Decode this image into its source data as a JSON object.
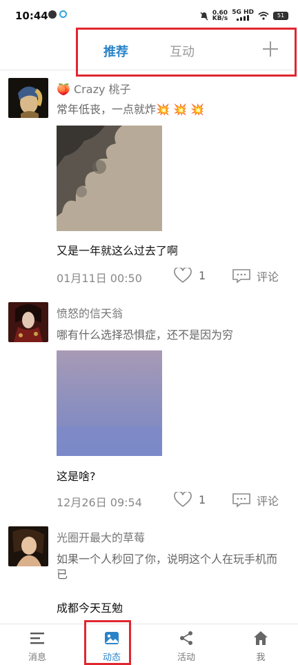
{
  "status": {
    "time": "10:44",
    "speed": "0.60",
    "speed_unit": "KB/s",
    "network": "5G HD",
    "battery": "51"
  },
  "tabs": {
    "recommend": "推荐",
    "interact": "互动"
  },
  "posts": [
    {
      "user": "🍑 Crazy 桃子",
      "text": "常年低丧，一点就炸💥 💥 💥",
      "caption": "又是一年就这么过去了啊",
      "date": "01月11日 00:50",
      "likes": "1",
      "comment": "评论"
    },
    {
      "user": "愤怒的信天翁",
      "text": "哪有什么选择恐惧症，还不是因为穷",
      "caption": "这是啥?",
      "date": "12月26日 09:54",
      "likes": "1",
      "comment": "评论"
    },
    {
      "user": "光圈开最大的草莓",
      "text": "如果一个人秒回了你，说明这个人在玩手机而已",
      "caption": "成都今天互勉"
    }
  ],
  "bottom_nav": {
    "messages": "消息",
    "moments": "动态",
    "activity": "活动",
    "me": "我"
  },
  "colors": {
    "accent": "#2a83c9",
    "highlight": "#e0262f"
  }
}
